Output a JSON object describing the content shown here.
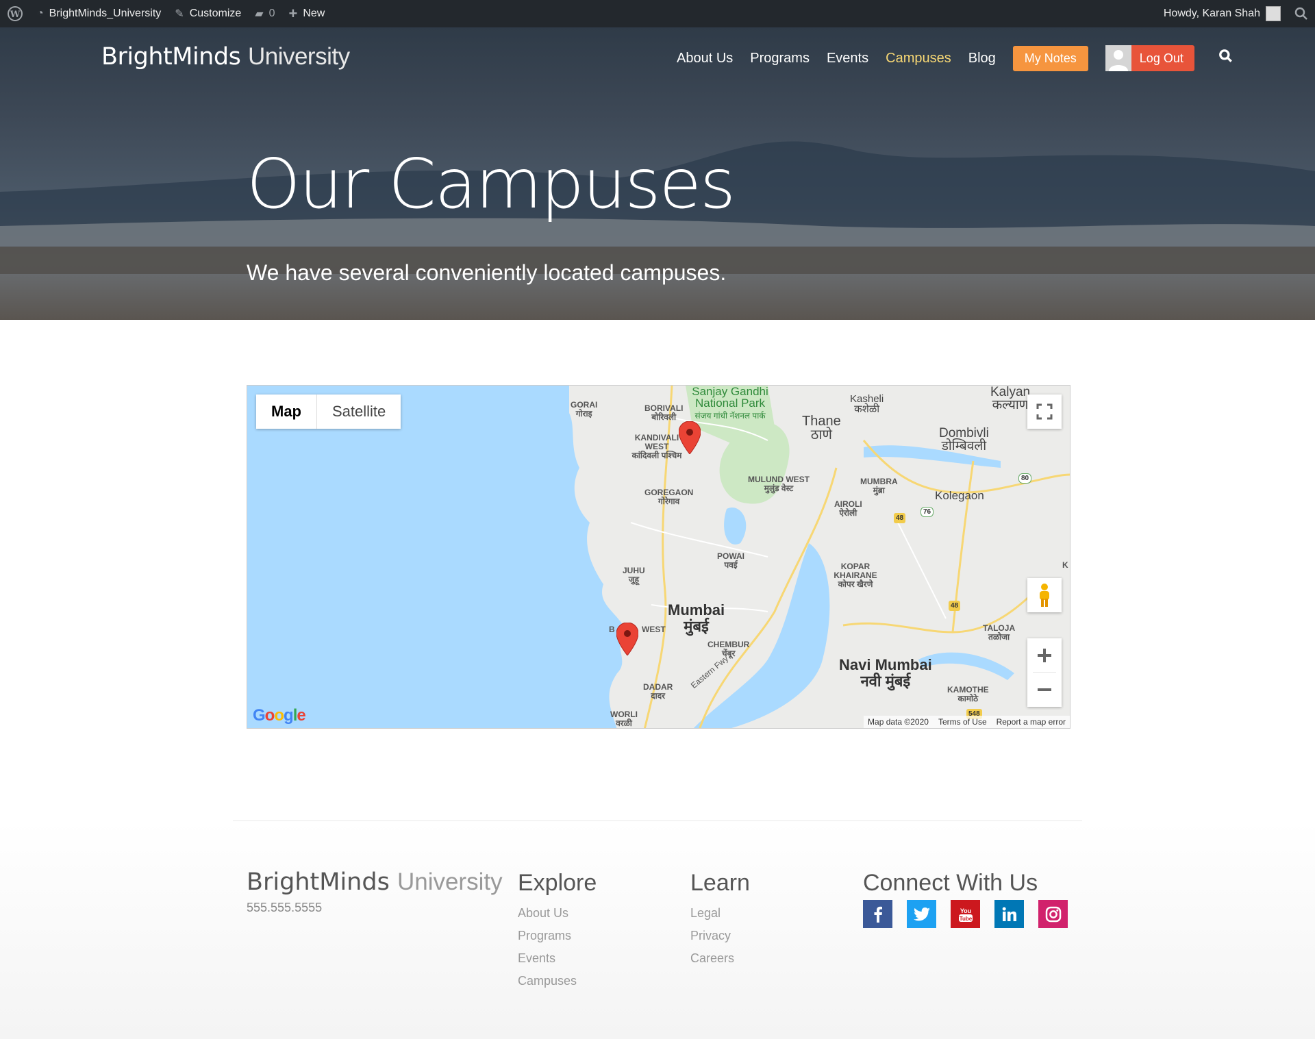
{
  "adminbar": {
    "site_name": "BrightMinds_University",
    "customize": "Customize",
    "comments_count": "0",
    "new_label": "New",
    "howdy": "Howdy, Karan Shah"
  },
  "header": {
    "brand_bold": "BrightMinds",
    "brand_light": "University",
    "nav": [
      "About Us",
      "Programs",
      "Events",
      "Campuses",
      "Blog"
    ],
    "active_nav": "Campuses",
    "my_notes": "My Notes",
    "log_out": "Log Out"
  },
  "hero": {
    "title": "Our Campuses",
    "subtitle": "We have several conveniently located campuses."
  },
  "map": {
    "type_map": "Map",
    "type_satellite": "Satellite",
    "attribution": [
      "Map data ©2020",
      "Terms of Use",
      "Report a map error"
    ],
    "labels": {
      "gorai": "GORAI",
      "gorai_mr": "गोराइ",
      "borivali": "BORIVALI",
      "borivali_mr": "बोरिवली",
      "kandivali": "KANDIVALI WEST",
      "kandivali_mr": "कांदिवली पश्चिम",
      "goregaon": "GOREGAON",
      "goregaon_mr": "गोरेगाव",
      "juhu": "JUHU",
      "juhu_mr": "जुहू",
      "bwest": "WEST",
      "dadar": "DADAR",
      "dadar_mr": "दादर",
      "worli": "WORLI",
      "worli_mr": "वरळी",
      "chembur": "CHEMBUR",
      "chembur_mr": "चेंबूर",
      "powai": "POWAI",
      "powai_mr": "पवई",
      "mulund": "MULUND WEST",
      "mulund_mr": "मुलुंड वेस्ट",
      "mumbra": "MUMBRA",
      "mumbra_mr": "मुंब्रा",
      "airoli": "AIROLI",
      "airoli_mr": "ऐरोली",
      "kopar": "KOPAR KHAIRANE",
      "kopar_mr": "कोपर खैरणे",
      "taloja": "TALOJA",
      "taloja_mr": "तळोजा",
      "kamothe": "KAMOTHE",
      "kamothe_mr": "कामोठे",
      "park": "Sanjay Gandhi National Park",
      "park_mr": "संजय गांधी नॅशनल पार्क",
      "thane": "Thane",
      "thane_mr": "ठाणे",
      "kasheli": "Kasheli",
      "kasheli_mr": "कशेळी",
      "kalyan": "Kalyan",
      "kalyan_mr": "कल्याण",
      "dombivli": "Dombivli",
      "dombivli_mr": "डोम्बिवली",
      "kolegaon": "Kolegaon",
      "mumbai": "Mumbai",
      "mumbai_mr": "मुंबई",
      "navi": "Navi Mumbai",
      "navi_mr": "नवी मुंबई",
      "eastern": "Eastern Fwy",
      "k": "K",
      "b": "B",
      "h48": "48",
      "h76": "76",
      "h80": "80",
      "h548": "548"
    }
  },
  "footer": {
    "brand_bold": "BrightMinds",
    "brand_light": "University",
    "phone": "555.555.5555",
    "explore_title": "Explore",
    "explore": [
      "About Us",
      "Programs",
      "Events",
      "Campuses"
    ],
    "learn_title": "Learn",
    "learn": [
      "Legal",
      "Privacy",
      "Careers"
    ],
    "connect_title": "Connect With Us",
    "social_colors": {
      "facebook": "#3b5998",
      "twitter": "#1da1f2",
      "youtube": "#cc181e",
      "linkedin": "#0077b5",
      "instagram": "#d1226c"
    }
  }
}
